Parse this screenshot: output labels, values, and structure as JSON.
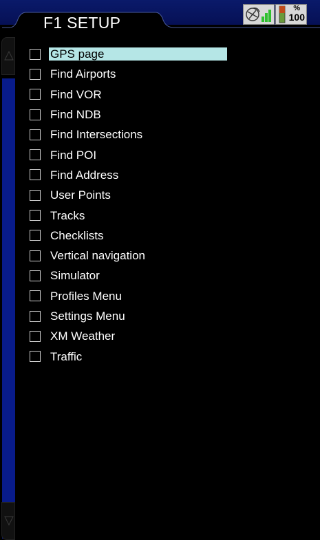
{
  "header": {
    "title": "F1 SETUP",
    "battery_percent_symbol": "%",
    "battery_value": "100",
    "icons": [
      "gps-signal-icon",
      "signal-bars-icon",
      "battery-icon"
    ]
  },
  "colors": {
    "header_band": "#0a1a6a",
    "scroll_track": "#081b8a",
    "selected_bg": "#b5e6e6",
    "signal_green": "#2fc02f"
  },
  "menu": {
    "items": [
      {
        "label": "GPS page",
        "checked": false,
        "selected": true
      },
      {
        "label": "Find Airports",
        "checked": false,
        "selected": false
      },
      {
        "label": "Find VOR",
        "checked": false,
        "selected": false
      },
      {
        "label": "Find NDB",
        "checked": false,
        "selected": false
      },
      {
        "label": "Find Intersections",
        "checked": false,
        "selected": false
      },
      {
        "label": "Find POI",
        "checked": false,
        "selected": false
      },
      {
        "label": "Find Address",
        "checked": false,
        "selected": false
      },
      {
        "label": "User Points",
        "checked": false,
        "selected": false
      },
      {
        "label": "Tracks",
        "checked": false,
        "selected": false
      },
      {
        "label": "Checklists",
        "checked": false,
        "selected": false
      },
      {
        "label": "Vertical navigation",
        "checked": false,
        "selected": false
      },
      {
        "label": "Simulator",
        "checked": false,
        "selected": false
      },
      {
        "label": "Profiles Menu",
        "checked": false,
        "selected": false
      },
      {
        "label": "Settings Menu",
        "checked": false,
        "selected": false
      },
      {
        "label": "XM Weather",
        "checked": false,
        "selected": false
      },
      {
        "label": "Traffic",
        "checked": false,
        "selected": false
      }
    ]
  }
}
